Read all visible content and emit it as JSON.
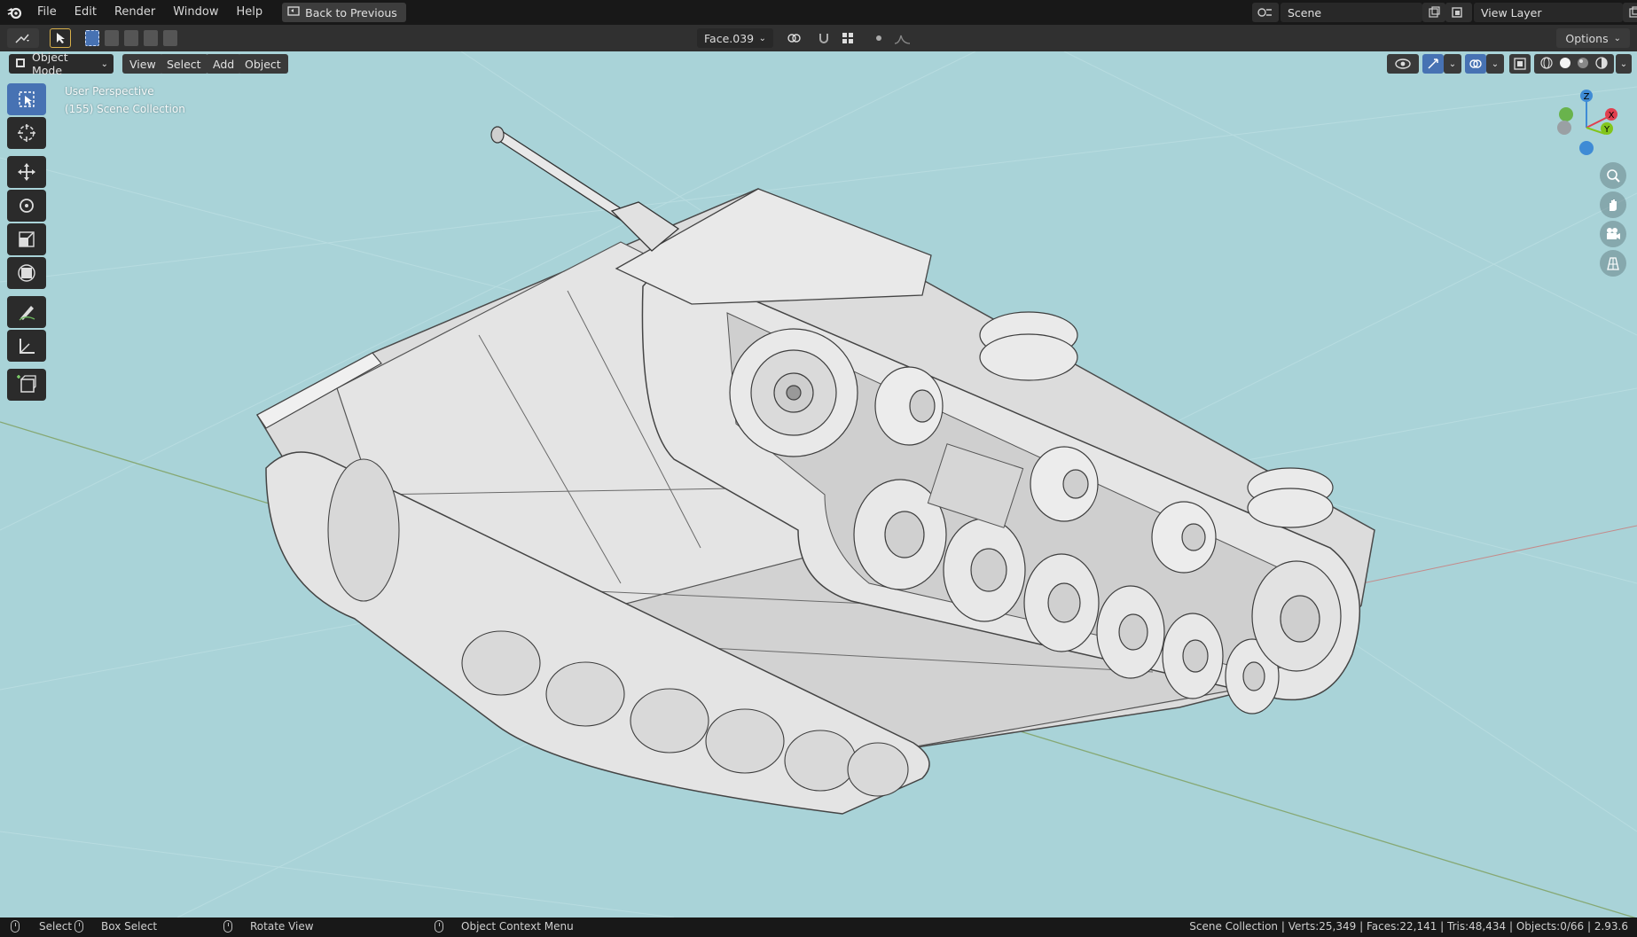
{
  "menubar": {
    "items": [
      "File",
      "Edit",
      "Render",
      "Window",
      "Help"
    ],
    "back_button": "Back to Previous",
    "scene": "Scene",
    "view_layer": "View Layer"
  },
  "toolheader": {
    "face_selector": "Face.039",
    "options_label": "Options"
  },
  "viewport_header": {
    "mode": "Object Mode",
    "menus": [
      "View",
      "Select",
      "Add",
      "Object"
    ]
  },
  "viewport": {
    "perspective_label": "User Perspective",
    "collection_label": "(155) Scene Collection",
    "background_color": "#a9d3d8",
    "axes": [
      "Z",
      "X",
      "Y"
    ],
    "axis_colors": {
      "x": "#e0404f",
      "y": "#82c51b",
      "z": "#3f8bd5"
    }
  },
  "toolbar": {
    "tools": [
      "select-box-icon",
      "cursor-icon",
      "move-icon",
      "rotate-icon",
      "scale-icon",
      "transform-icon",
      "annotate-icon",
      "measure-icon",
      "add-cube-icon"
    ]
  },
  "statusbar": {
    "select": "Select",
    "box_select": "Box Select",
    "rotate_view": "Rotate View",
    "context_menu": "Object Context Menu",
    "stats": "Scene Collection | Verts:25,349 | Faces:22,141 | Tris:48,434 | Objects:0/66 | 2.93.6"
  }
}
